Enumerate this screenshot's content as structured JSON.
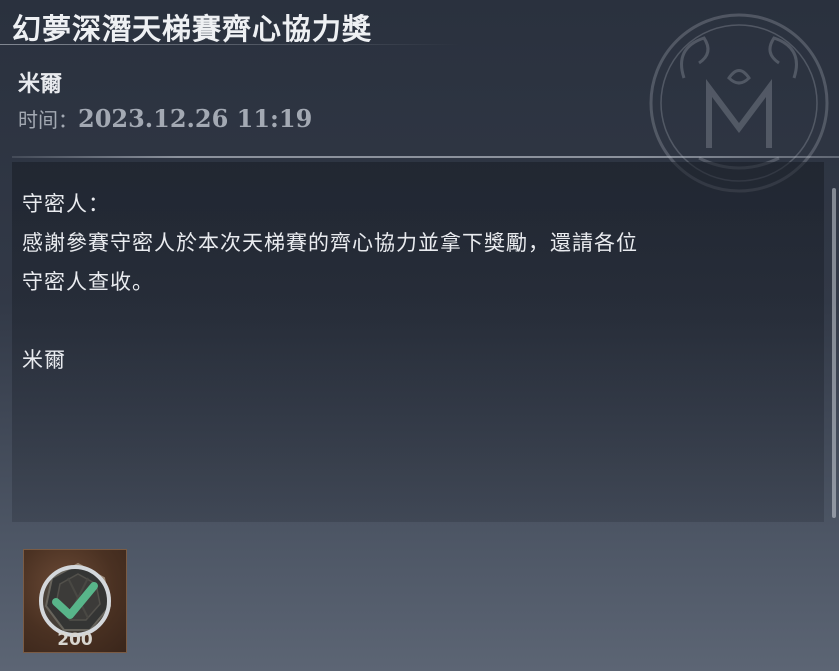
{
  "mail": {
    "title": "幻夢深潛天梯賽齊心協力獎",
    "sender": "米爾",
    "time_label": "时间：",
    "time_value": "2023.12.26 11:19",
    "body": {
      "greeting": "守密人：",
      "line1": "感謝參賽守密人於本次天梯賽的齊心協力並拿下獎勵，還請各位",
      "line2": "守密人查收。",
      "signature": "米爾"
    },
    "attachment": {
      "quantity": "200",
      "claimed": true,
      "icon": "currency-item-icon",
      "status_icon": "claimed-check-icon"
    },
    "seal_icon": "monogram-seal-icon"
  },
  "colors": {
    "background_top": "#2a313e",
    "background_bottom": "#5c6574",
    "check_green": "#58b58a",
    "attachment_bg": "#4a3122"
  }
}
